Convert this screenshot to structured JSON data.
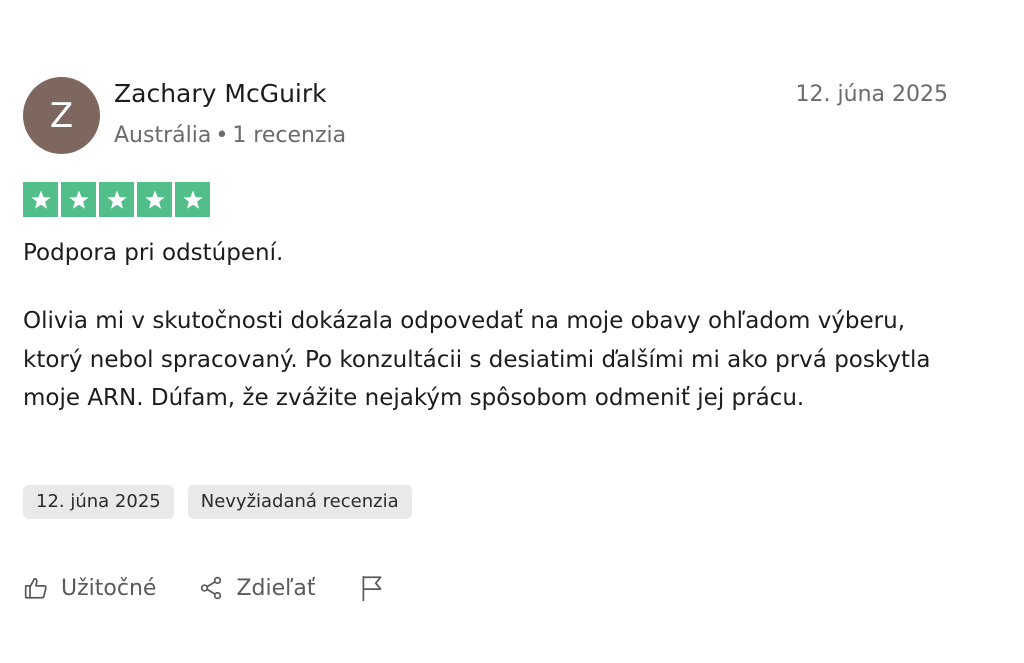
{
  "reviewer": {
    "initial": "Z",
    "name": "Zachary McGuirk",
    "country": "Austrália",
    "separator": "•",
    "review_count": "1 recenzia",
    "avatar_color": "#7d675f"
  },
  "review": {
    "date": "12. júna 2025",
    "rating": 5,
    "rating_max": 5,
    "star_color": "#52bf8b",
    "title": "Podpora pri odstúpení.",
    "body": "Olivia mi v skutočnosti dokázala odpovedať na moje obavy ohľadom výberu, ktorý nebol spracovaný. Po konzultácii s desiatimi ďalšími mi ako prvá poskytla moje ARN. Dúfam, že zvážite nejakým spôsobom odmeniť jej prácu."
  },
  "tags": {
    "date_tag": "12. júna 2025",
    "type_tag": "Nevyžiadaná recenzia"
  },
  "actions": {
    "useful_label": "Užitočné",
    "useful_icon": "thumbs-up-icon",
    "share_label": "Zdieľať",
    "share_icon": "share-icon",
    "report_icon": "flag-icon"
  }
}
